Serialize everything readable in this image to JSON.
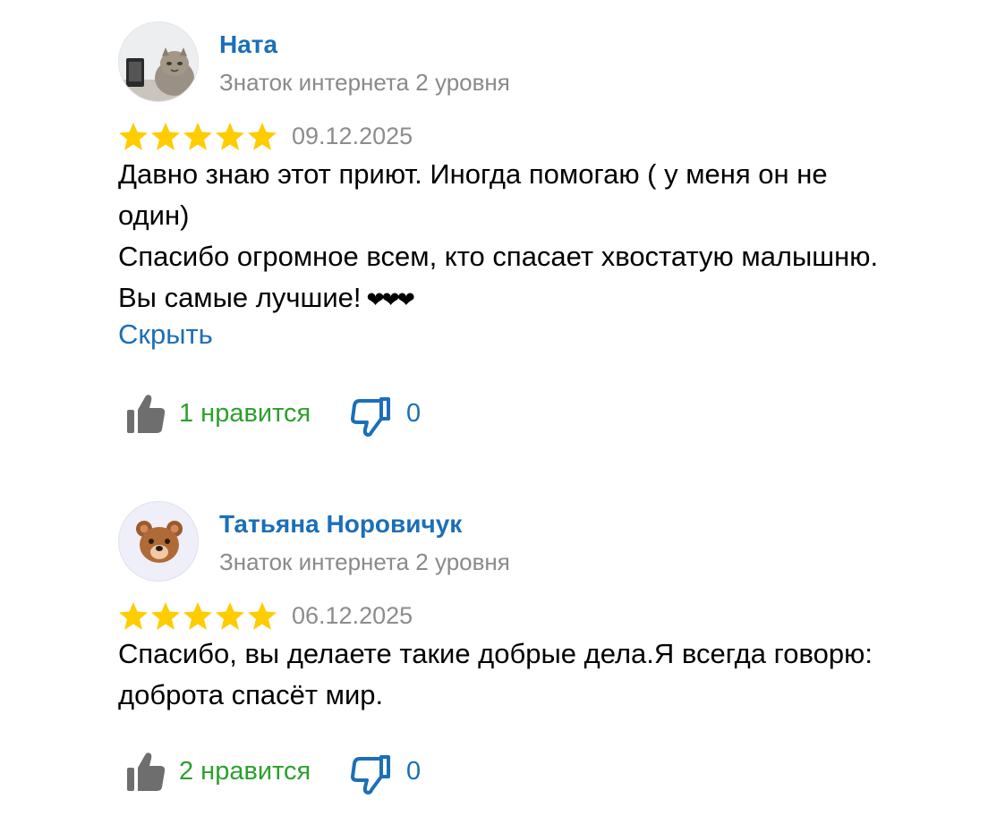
{
  "colors": {
    "author_link": "#1b6fb8",
    "level_text": "#8a8a8a",
    "star": "#ffcc00",
    "like": "#2ca02c",
    "dislike": "#1b6fb8"
  },
  "reviews": [
    {
      "author": "Ната",
      "level": "Знаток интернета 2 уровня",
      "avatar": "cat-photo",
      "rating": 5,
      "date": "09.12.2025",
      "text_lines": [
        "Давно знаю этот приют. Иногда помогаю ( у меня он не один)",
        "Спасибо огромное всем, кто спасает хвостатую малышню. Вы самые лучшие!"
      ],
      "hearts": "❤❤❤",
      "hide_label": "Скрыть",
      "likes": "1 нравится",
      "dislikes": "0"
    },
    {
      "author": "Татьяна Норовичук",
      "level": "Знаток интернета 2 уровня",
      "avatar": "bear-emoji",
      "rating": 5,
      "date": "06.12.2025",
      "text_lines": [
        "Спасибо, вы делаете  такие добрые дела.Я всегда говорю: доброта спасёт мир."
      ],
      "likes": "2 нравится",
      "dislikes": "0"
    }
  ]
}
